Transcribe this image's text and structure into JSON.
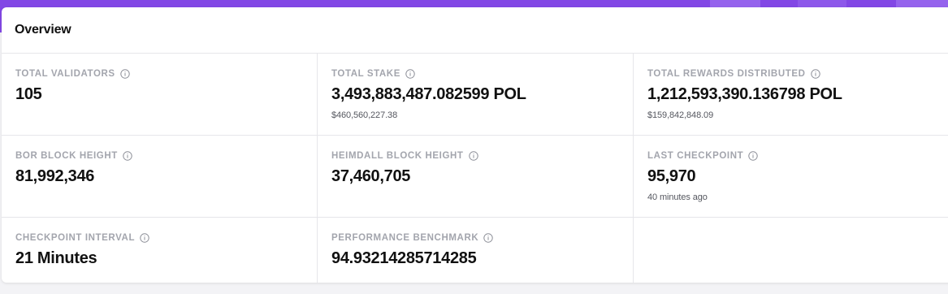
{
  "overview": {
    "title": "Overview"
  },
  "stats": [
    {
      "label": "TOTAL VALIDATORS",
      "value": "105",
      "sub": ""
    },
    {
      "label": "TOTAL STAKE",
      "value": "3,493,883,487.082599 POL",
      "sub": "$460,560,227.38"
    },
    {
      "label": "TOTAL REWARDS DISTRIBUTED",
      "value": "1,212,593,390.136798 POL",
      "sub": "$159,842,848.09"
    },
    {
      "label": "BOR BLOCK HEIGHT",
      "value": "81,992,346",
      "sub": ""
    },
    {
      "label": "HEIMDALL BLOCK HEIGHT",
      "value": "37,460,705",
      "sub": ""
    },
    {
      "label": "LAST CHECKPOINT",
      "value": "95,970",
      "sub": "40 minutes ago"
    },
    {
      "label": "CHECKPOINT INTERVAL",
      "value": "21 Minutes",
      "sub": ""
    },
    {
      "label": "PERFORMANCE BENCHMARK",
      "value": "94.9321428571428​5",
      "sub": ""
    }
  ],
  "icons": {
    "info": "info-circle-icon"
  },
  "colors": {
    "accent": "#8247e5",
    "label": "#a3a5ad",
    "value": "#111111"
  }
}
